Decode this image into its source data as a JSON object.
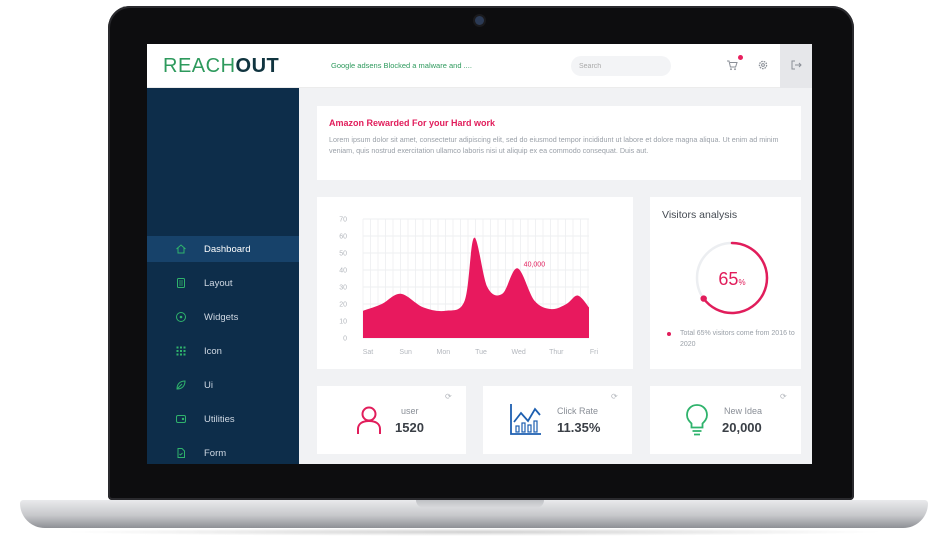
{
  "brand": {
    "part1": "REACH",
    "part2": "OUT"
  },
  "topbar": {
    "ticker": "Google adsens Blocked a malware and ....",
    "search_placeholder": "Search",
    "icons": [
      "cart-icon",
      "settings-icon",
      "logout-icon"
    ]
  },
  "sidebar": {
    "items": [
      {
        "label": "Dashboard",
        "icon": "home-icon",
        "active": true
      },
      {
        "label": "Layout",
        "icon": "layout-icon",
        "active": false
      },
      {
        "label": "Widgets",
        "icon": "widgets-icon",
        "active": false
      },
      {
        "label": "Icon",
        "icon": "grid-icon",
        "active": false
      },
      {
        "label": "Ui",
        "icon": "leaf-icon",
        "active": false
      },
      {
        "label": "Utilities",
        "icon": "utilities-icon",
        "active": false
      },
      {
        "label": "Form",
        "icon": "form-icon",
        "active": false
      }
    ]
  },
  "alert": {
    "title": "Amazon Rewarded For your Hard work",
    "body": "Lorem ipsum dolor sit amet, consectetur adipiscing elit, sed do eiusmod tempor incididunt ut labore et dolore magna aliqua. Ut enim ad minim veniam, quis nostrud exercitation ullamco laboris nisi ut aliquip ex ea commodo consequat. Duis aut."
  },
  "chart_data": {
    "type": "area",
    "categories": [
      "Sat",
      "Sun",
      "Mon",
      "Tue",
      "Wed",
      "Thur",
      "Fri"
    ],
    "y_ticks": [
      0,
      10,
      20,
      30,
      40,
      50,
      60,
      70
    ],
    "ylim": [
      0,
      70
    ],
    "series": [
      {
        "x": [
          0,
          0.5,
          1,
          1.6,
          2.2,
          2.7,
          2.95,
          3.3,
          3.7,
          4.1,
          4.55,
          5.0,
          5.4,
          5.7,
          6.0
        ],
        "values": [
          16,
          20,
          26,
          18,
          16,
          22,
          59,
          30,
          26,
          41,
          22,
          17,
          20,
          25,
          18
        ]
      }
    ],
    "annotation": {
      "text": "40,000",
      "x": 4.55,
      "y": 41
    },
    "grid": true,
    "color": "#e8195e"
  },
  "visitors": {
    "title": "Visitors analysis",
    "percent_value": 65,
    "percent": "65",
    "percent_unit": "%",
    "note": "Total 65% visitors come from 2016 to 2020",
    "color": "#e11d5b"
  },
  "stats": [
    {
      "label": "user",
      "value": "1520",
      "icon": "user-icon",
      "color": "#e11d5b"
    },
    {
      "label": "Click Rate",
      "value": "11.35%",
      "icon": "bar-chart-icon",
      "color": "#1d5fb0"
    },
    {
      "label": "New Idea",
      "value": "20,000",
      "icon": "lightbulb-icon",
      "color": "#2fb36c"
    }
  ]
}
